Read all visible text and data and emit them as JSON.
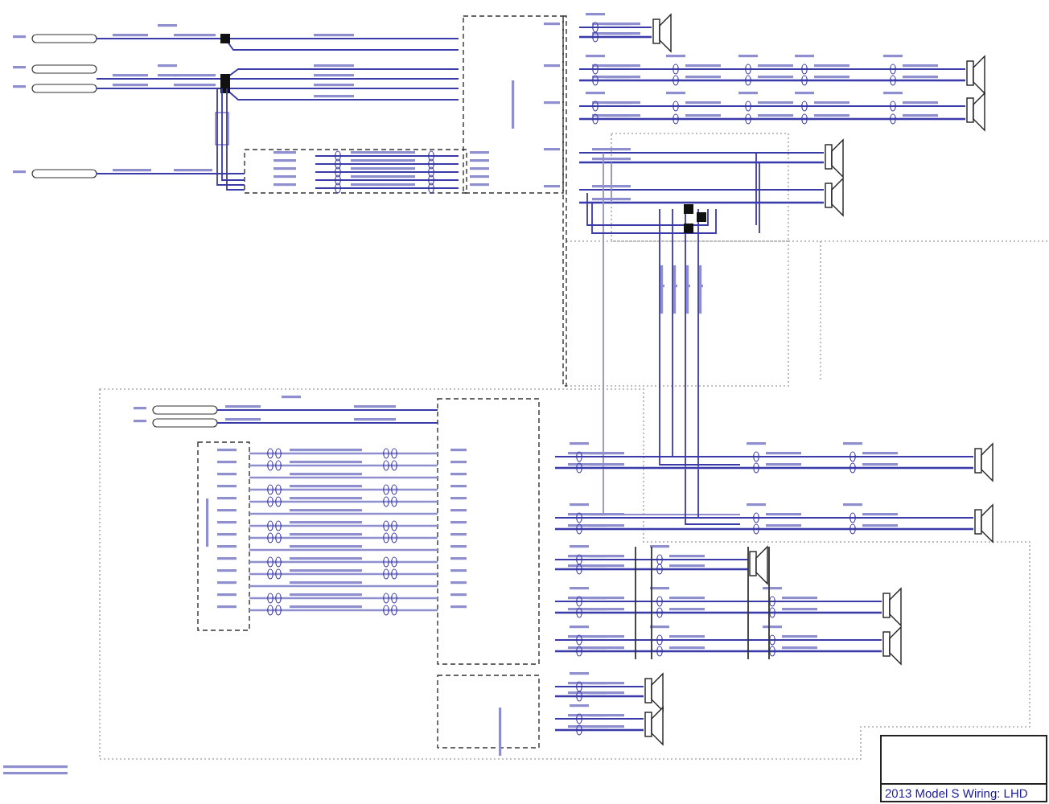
{
  "title_block": {
    "title": "2013 Model S Wiring: LHD"
  }
}
